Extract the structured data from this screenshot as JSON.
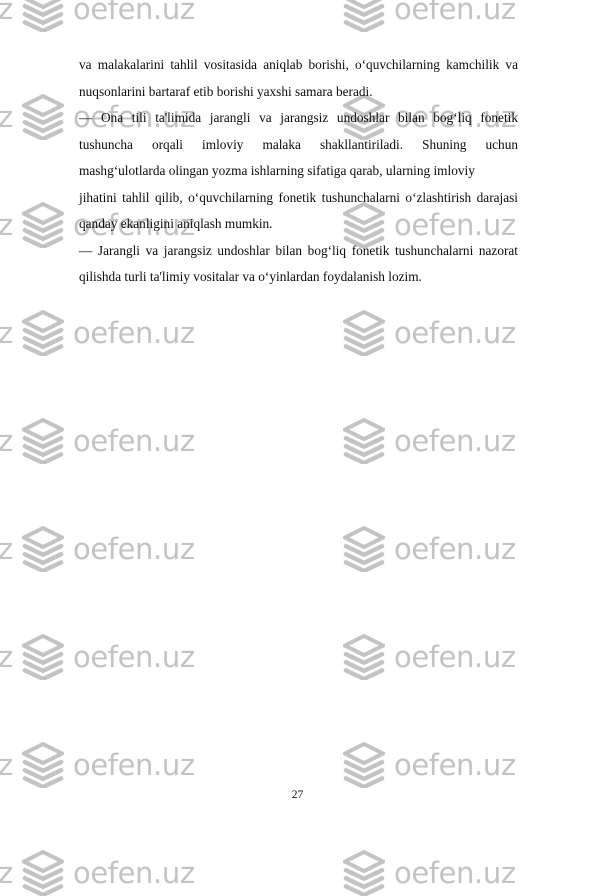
{
  "document": {
    "page_number": "27",
    "paragraphs": [
      {
        "id": "para-1",
        "lines": [
          "va  malakalarini  tahlil  vositasida  aniqlab  borishi,  oʻquvchilarning  kamchilik  va",
          "nuqsonlarini  bartaraf etib borishi yaxshi samara beradi."
        ],
        "text": "va malakalarini tahlil vositasida aniqlab borishi, oʻquvchilarning kamchilik va nuqsonlarini bartaraf etib borishi yaxshi samara beradi."
      },
      {
        "id": "para-2",
        "lines": [
          "—  Ona  tili  ta'limida  jarangli  va  jarangsiz  undoshlar  bilan  bogʻliq  fonetik",
          "tushuncha  orqali  imloviy  malaka  shakllantiriladi.  Shuning  uchun",
          "mashgʻulotlarda olingan  yozma  ishlarning  sifatiga  qarab,  ularning imloviy",
          "jihatini  tahlil  qilib,  oʻquvchilarning  fonetik  tushunchalarni  oʻzlashtirish  darajasi",
          "qanday  ekanligini aniqlash mumkin."
        ],
        "text": "— Ona tili ta'limida jarangli va jarangsiz undoshlar bilan bogʻliq fonetik tushuncha orqali imloviy malaka shakllantiriladi. Shuning uchun mashgʻulotlarda olingan yozma ishlarning sifatiga qarab, ularning imloviy jihatini tahlil qilib, oʻquvchilarning fonetik tushunchalarni oʻzlashtirish darajasi qanday ekanligini aniqlash mumkin."
      },
      {
        "id": "para-3",
        "lines": [
          "— Jarangli  va  jarangsiz  undoshlar  bilan  bogʻliq  fonetik  tushunchalarni  nazorat",
          "qilishda turli  ta'limiy  vositalar  va oʻyinlardan foydalanish lozim."
        ],
        "text": "— Jarangli va jarangsiz undoshlar bilan bogʻliq fonetik tushunchalarni nazorat qilishda turli ta'limiy vositalar va oʻyinlardan foydalanish lozim."
      }
    ]
  },
  "watermark": {
    "text": "oefen.uz",
    "color": "#c3c3c3",
    "logo_name": "stacked-layers-logo"
  },
  "colors": {
    "page_background": "#ffffff",
    "body_text": "#0b0b0b",
    "watermark": "#c3c3c3"
  }
}
